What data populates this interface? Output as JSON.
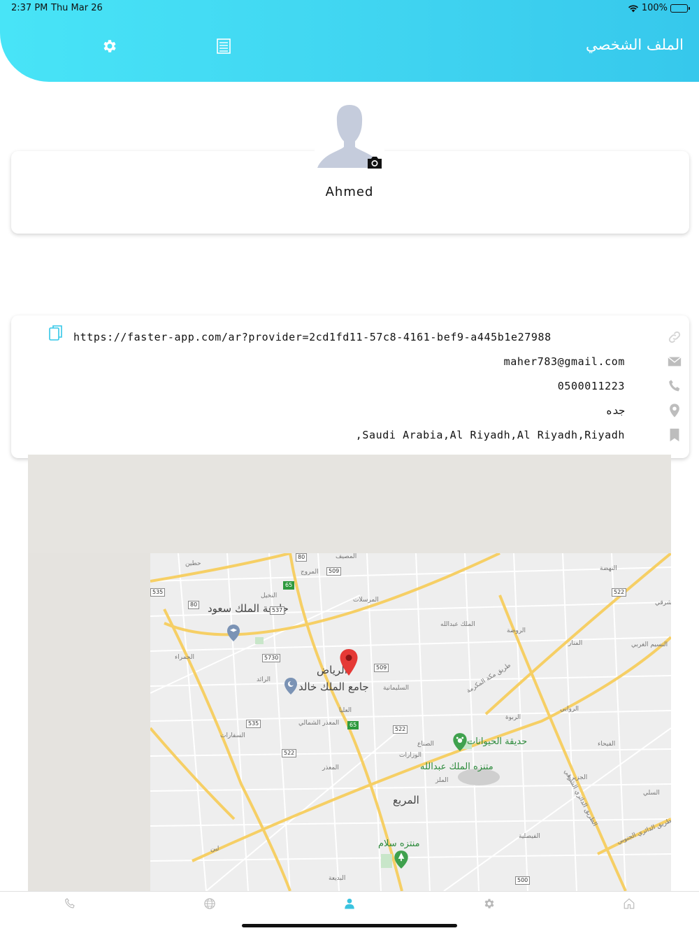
{
  "status": {
    "time": "2:37 PM",
    "date": "Thu Mar 26",
    "battery": "100%"
  },
  "header": {
    "title": "الملف الشخصي",
    "left_icon": "gear-icon",
    "list_icon": "list-icon"
  },
  "profile": {
    "name": "Ahmed",
    "avatar_icon": "avatar-placeholder",
    "camera_icon": "camera-icon"
  },
  "info": {
    "link": "https://faster-app.com/ar?provider=2cd1fd11-57c8-4161-bef9-a445b1e27988",
    "email": "maher783@gmail.com",
    "phone": "0500011223",
    "city": "جده",
    "address": ",Saudi Arabia,Al Riyadh,Al Riyadh,Riyadh"
  },
  "map": {
    "city_label": "الرياض",
    "places": [
      "جامعة الملك سعود",
      "جامع الملك خالد",
      "حديقة الحيوانات",
      "متنزه الملك عبدالله",
      "المربع",
      "منتزه سلام",
      "طريق مكة المكرمة",
      "الطريق الدائري الشرقي",
      "الطريق الدائري الجنوبي"
    ],
    "districts": [
      "حطين",
      "المصيف",
      "المروج",
      "النخيل",
      "المرسلات",
      "الملك عبدالله",
      "الروضة",
      "النهضة",
      "الحمراء",
      "الرائد",
      "العليا",
      "السليمانية",
      "المعذر الشمالي",
      "الوزارات",
      "الصناع",
      "الربوة",
      "الروابي",
      "المنار",
      "الفيحاء",
      "الجزيرة",
      "السلي",
      "الفيصلية",
      "المعذر",
      "السفارات",
      "لبن",
      "البديعة",
      "النسيم الشرقي",
      "النسيم الغربي",
      "الملز"
    ],
    "route_shields": [
      "80",
      "509",
      "535",
      "65",
      "80",
      "537",
      "5730",
      "509",
      "65",
      "522",
      "535",
      "522",
      "522",
      "500"
    ]
  },
  "tabs": [
    "phone-icon",
    "globe-icon",
    "profile-icon",
    "settings-icon",
    "home-icon"
  ],
  "colors": {
    "accent": "#3fd3f0",
    "tab_active": "#3ac3df",
    "icon_gray": "#b8b8b8"
  }
}
